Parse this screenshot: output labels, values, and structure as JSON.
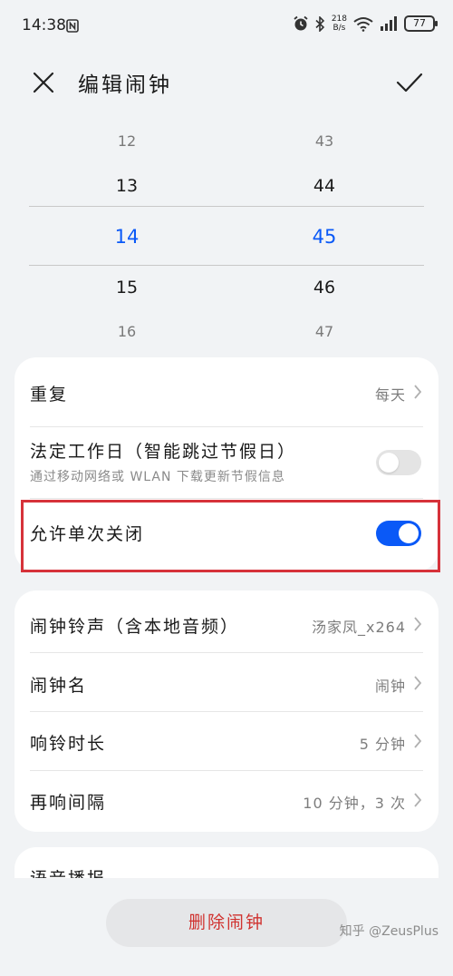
{
  "status_bar": {
    "time": "14:38",
    "net_speed_value": "218",
    "net_speed_unit": "B/s",
    "battery": "77"
  },
  "header": {
    "title": "编辑闹钟"
  },
  "time_picker": {
    "hours": [
      "12",
      "13",
      "14",
      "15",
      "16"
    ],
    "minutes": [
      "43",
      "44",
      "45",
      "46",
      "47"
    ],
    "selected_hour": "14",
    "selected_minute": "45"
  },
  "settings": {
    "repeat": {
      "label": "重复",
      "value": "每天"
    },
    "workday": {
      "label": "法定工作日（智能跳过节假日）",
      "subtitle": "通过移动网络或 WLAN 下载更新节假信息",
      "enabled": false
    },
    "single_close": {
      "label": "允许单次关闭",
      "enabled": true
    }
  },
  "alarm_options": {
    "ringtone": {
      "label": "闹钟铃声（含本地音频）",
      "value": "汤家凤_x264"
    },
    "name": {
      "label": "闹钟名",
      "value": "闹钟"
    },
    "duration": {
      "label": "响铃时长",
      "value": "5 分钟"
    },
    "snooze": {
      "label": "再响间隔",
      "value": "10 分钟，3 次"
    }
  },
  "voice": {
    "label": "语音播报"
  },
  "delete_button": "删除闹钟",
  "watermark": "知乎 @ZeusPlus",
  "colors": {
    "accent": "#0a59f7",
    "danger": "#d0322f",
    "highlight_border": "#d6323a",
    "background": "#f1f3f5"
  }
}
